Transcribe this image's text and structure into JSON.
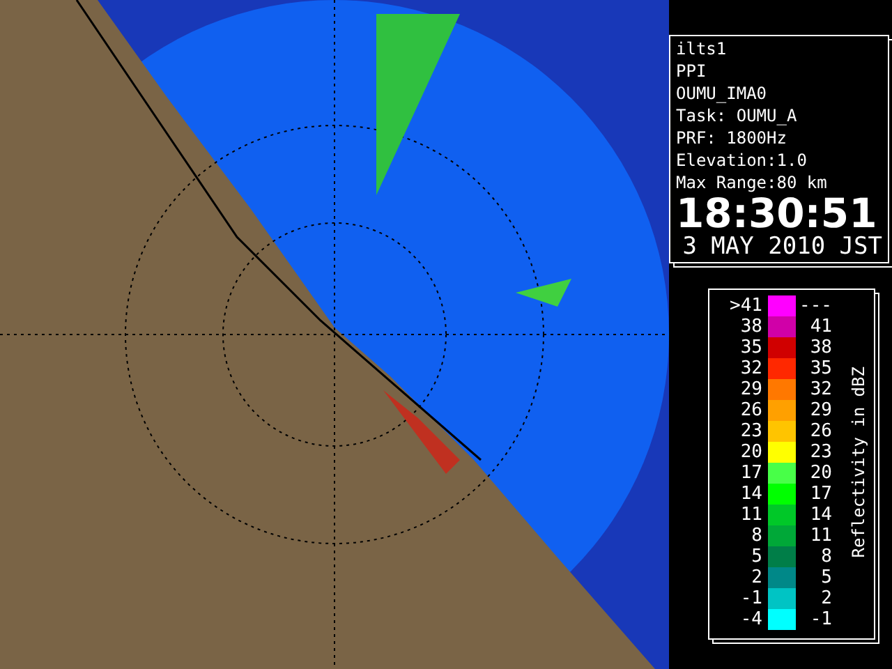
{
  "info": {
    "lines": [
      "ilts1",
      "PPI",
      "OUMU_IMA0",
      "Task: OUMU_A",
      "PRF: 1800Hz",
      "Elevation:1.0",
      "Max Range:80 km"
    ],
    "time": "18:30:51",
    "date": "3 MAY 2010 JST"
  },
  "legend": {
    "title": "Reflectivity in dBZ",
    "rows": [
      {
        "low": ">41",
        "high": "---",
        "color": "#ff00ff"
      },
      {
        "low": "38",
        "high": "41",
        "color": "#d000a8"
      },
      {
        "low": "35",
        "high": "38",
        "color": "#d00000"
      },
      {
        "low": "32",
        "high": "35",
        "color": "#ff2800"
      },
      {
        "low": "29",
        "high": "32",
        "color": "#ff7800"
      },
      {
        "low": "26",
        "high": "29",
        "color": "#ffa000"
      },
      {
        "low": "23",
        "high": "26",
        "color": "#ffc400"
      },
      {
        "low": "20",
        "high": "23",
        "color": "#ffff00"
      },
      {
        "low": "17",
        "high": "20",
        "color": "#48ff48"
      },
      {
        "low": "14",
        "high": "17",
        "color": "#00ff00"
      },
      {
        "low": "11",
        "high": "14",
        "color": "#00c828"
      },
      {
        "low": "8",
        "high": "11",
        "color": "#00a838"
      },
      {
        "low": "5",
        "high": "8",
        "color": "#007e48"
      },
      {
        "low": "2",
        "high": "5",
        "color": "#008888"
      },
      {
        "low": "-1",
        "high": "2",
        "color": "#00c4c4"
      },
      {
        "low": "-4",
        "high": "-1",
        "color": "#00ffff"
      }
    ]
  }
}
